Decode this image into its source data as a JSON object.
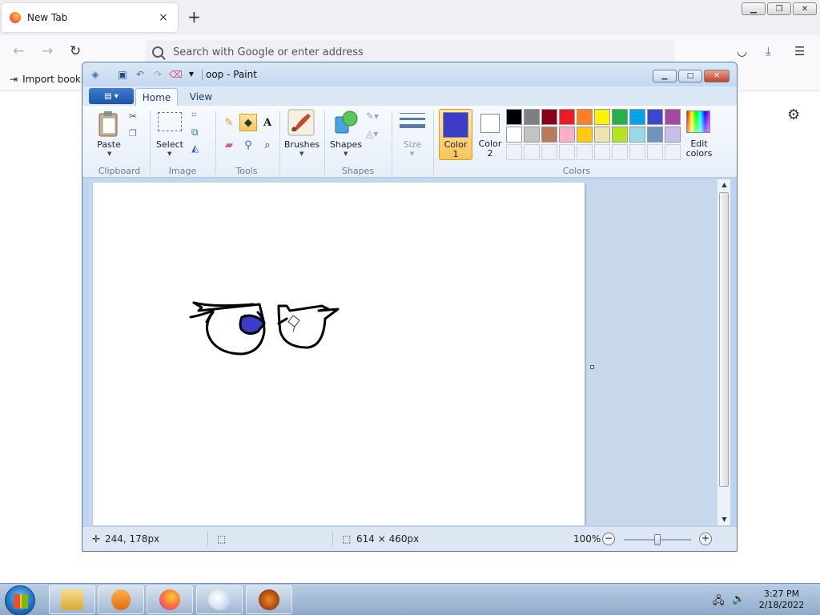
{
  "browser": {
    "tab_title": "New Tab",
    "tab_close": "×",
    "new_tab": "+",
    "address_placeholder": "Search with Google or enter address",
    "bookmark_import": "Import bookr",
    "icons": [
      "firefox-favicon",
      "back-arrow-icon",
      "forward-arrow-icon",
      "reload-icon",
      "search-icon",
      "pocket-icon",
      "download-icon",
      "menu-icon",
      "gear-icon"
    ]
  },
  "paint": {
    "title": "oop - Paint",
    "tabs": [
      "Home",
      "View"
    ],
    "groups": {
      "clipboard": "Clipboard",
      "image": "Image",
      "tools": "Tools",
      "shapes": "Shapes",
      "colors": "Colors"
    },
    "buttons": {
      "paste": "Paste",
      "select": "Select",
      "brushes": "Brushes",
      "shapes": "Shapes",
      "size": "Size",
      "color1_line1": "Color",
      "color1_line2": "1",
      "color2_line1": "Color",
      "color2_line2": "2",
      "edit_colors_line1": "Edit",
      "edit_colors_line2": "colors"
    },
    "color1": "#3c3cc8",
    "color2": "#ffffff",
    "palette_row1": [
      "#000000",
      "#7f7f7f",
      "#880015",
      "#ed1c24",
      "#ff7f27",
      "#fff200",
      "#22b14c",
      "#00a2e8",
      "#3f48cc",
      "#a349a4"
    ],
    "palette_row2": [
      "#ffffff",
      "#c3c3c3",
      "#b97a57",
      "#ffaec9",
      "#ffc90e",
      "#efe4b0",
      "#b5e61d",
      "#99d9ea",
      "#7092be",
      "#c8bfe7"
    ],
    "status": {
      "cursor": "244, 178px",
      "size": "614 × 460px",
      "zoom": "100%"
    },
    "zoom_level": 0.5
  },
  "taskbar": {
    "time": "3:27 PM",
    "date": "2/18/2022"
  }
}
